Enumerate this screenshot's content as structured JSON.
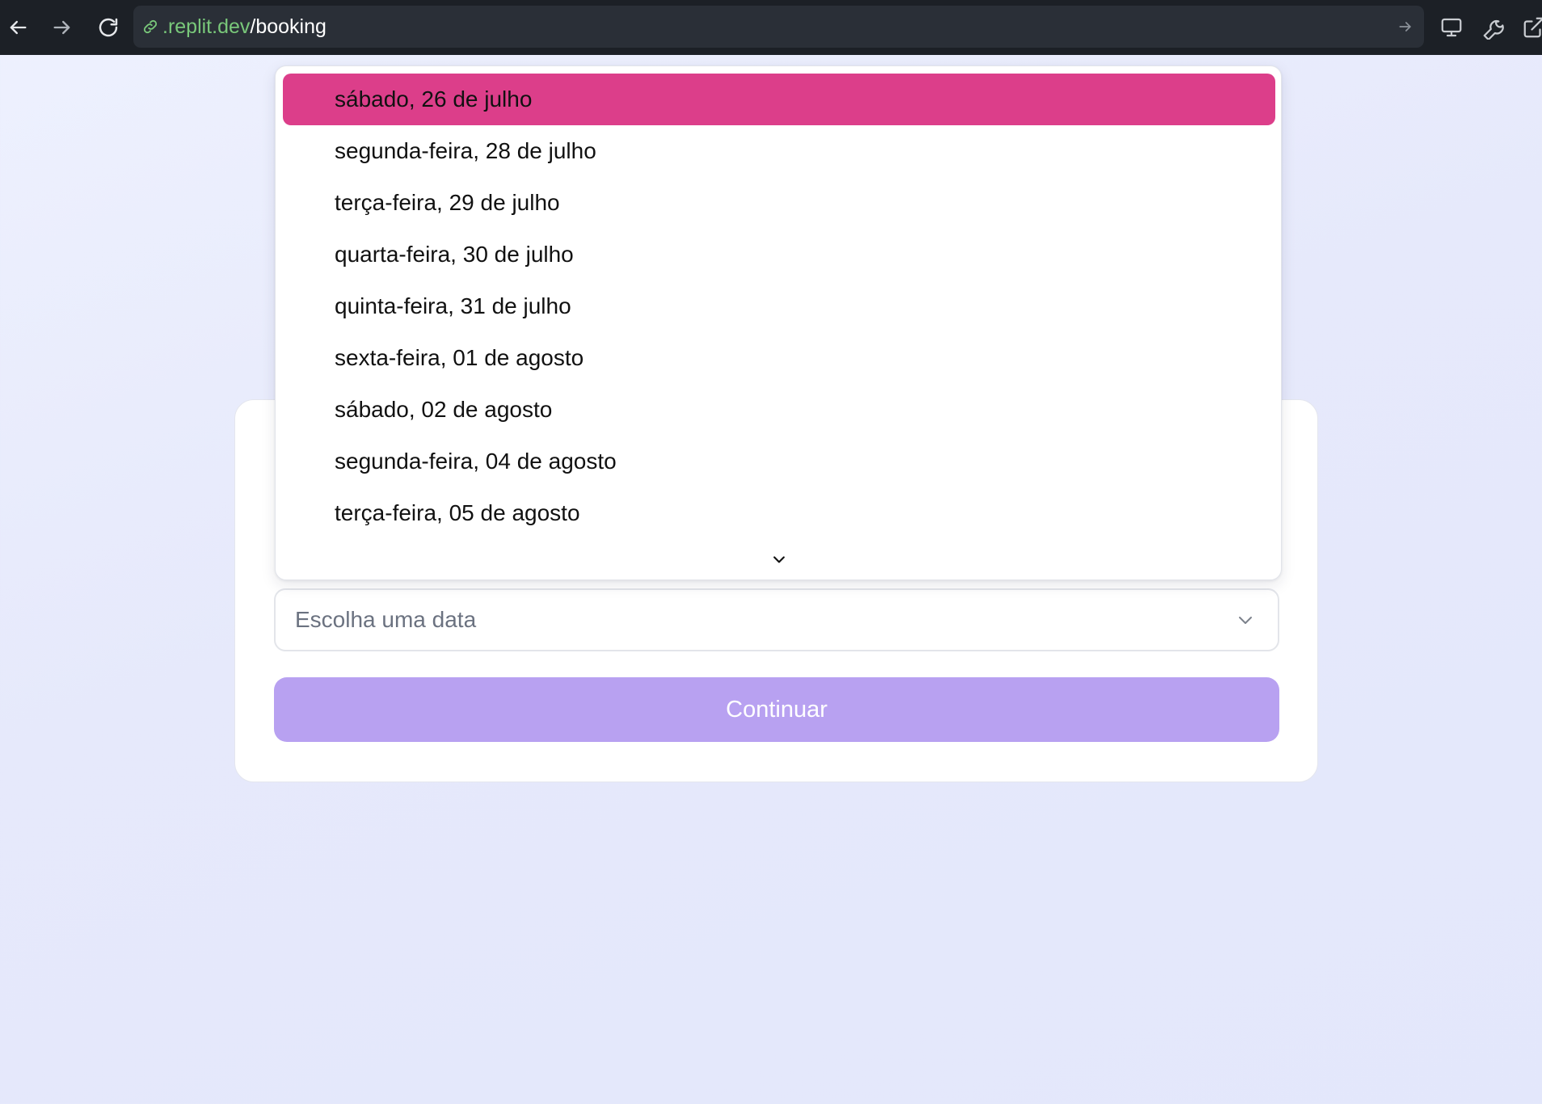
{
  "browser": {
    "url_domain": ".replit.dev",
    "url_path": "/booking",
    "icons": {
      "back": "arrow-left-icon",
      "forward": "arrow-right-icon",
      "reload": "reload-icon",
      "site": "link-icon",
      "go": "arrow-right-icon",
      "device": "monitor-icon",
      "devtools": "wrench-icon",
      "open_external": "external-link-icon"
    }
  },
  "booking": {
    "date_select": {
      "placeholder": "Escolha uma data",
      "icon": "chevron-down-icon"
    },
    "continue_label": "Continuar",
    "continue_enabled": false,
    "dropdown": {
      "options": [
        "sábado, 26 de julho",
        "segunda-feira, 28 de julho",
        "terça-feira, 29 de julho",
        "quarta-feira, 30 de julho",
        "quinta-feira, 31 de julho",
        "sexta-feira, 01 de agosto",
        "sábado, 02 de agosto",
        "segunda-feira, 04 de agosto",
        "terça-feira, 05 de agosto"
      ],
      "highlighted_index": 0,
      "scroll_icon": "chevron-down-icon"
    }
  },
  "colors": {
    "toolbar_bg": "#1c2026",
    "url_domain": "#79c87a",
    "highlight": "#dc3e8a",
    "button_disabled": "#b8a1f1",
    "page_bg": "#e6e9fb"
  }
}
